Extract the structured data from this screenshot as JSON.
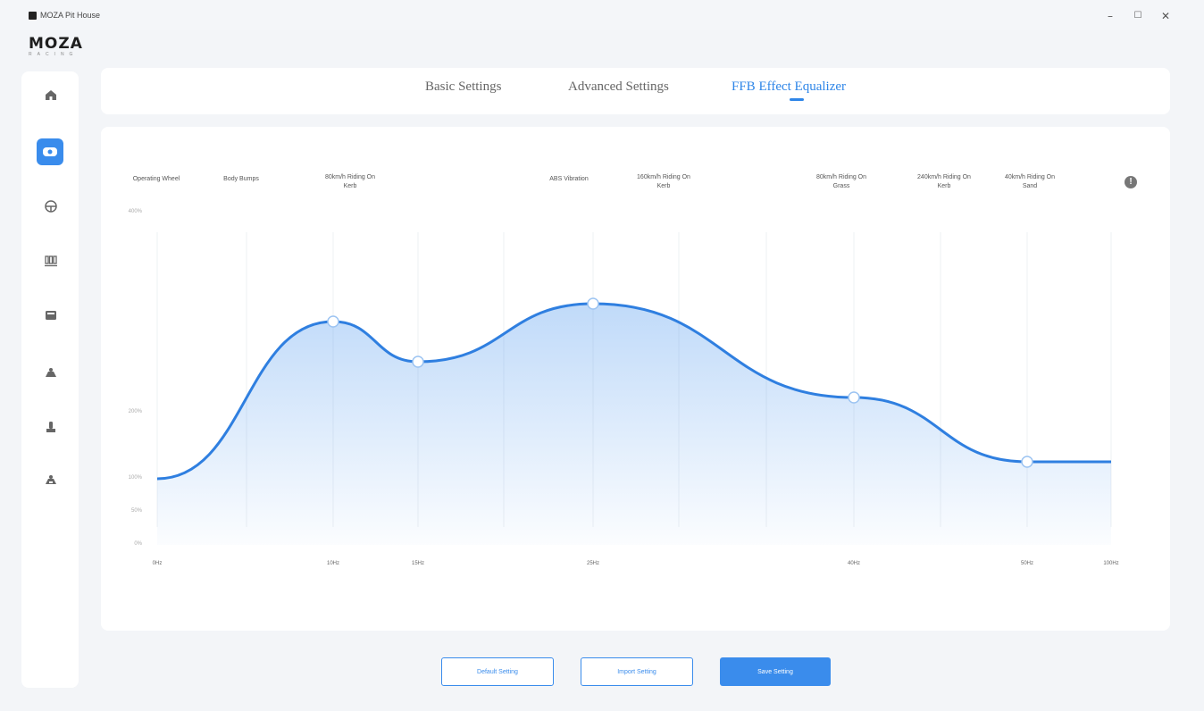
{
  "window": {
    "title": "MOZA Pit House",
    "minimize": "–",
    "maximize": "☐",
    "close": "✕"
  },
  "brand": {
    "logo": "MOZA",
    "subtitle": "RACING"
  },
  "sidebar": {
    "items": [
      {
        "icon": "home-icon"
      },
      {
        "icon": "wheelbase-icon",
        "active": true
      },
      {
        "icon": "steering-wheel-icon"
      },
      {
        "icon": "pedals-icon"
      },
      {
        "icon": "dashboard-icon"
      },
      {
        "icon": "shifter-icon"
      },
      {
        "icon": "handbrake-icon"
      },
      {
        "icon": "accessory-icon"
      }
    ]
  },
  "tabs": [
    {
      "label": "Basic Settings",
      "active": false
    },
    {
      "label": "Advanced Settings",
      "active": false
    },
    {
      "label": "FFB Effect Equalizer",
      "active": true
    }
  ],
  "chart_data": {
    "type": "area",
    "effect_labels": [
      "Operating Wheel",
      "Body Bumps",
      "80km/h Riding On Kerb",
      "ABS Vibration",
      "160km/h Riding On Kerb",
      "80km/h Riding On Grass",
      "240km/h Riding On Kerb",
      "40km/h Riding On Sand"
    ],
    "y_tick_labels": [
      "400%",
      "200%",
      "100%",
      "50%",
      "0%"
    ],
    "x_tick_labels": [
      "0Hz",
      "10Hz",
      "15Hz",
      "25Hz",
      "40Hz",
      "50Hz",
      "100Hz"
    ],
    "series": [
      {
        "points": [
          {
            "x": "0Hz",
            "y": 100
          },
          {
            "x": "10Hz",
            "y": 300
          },
          {
            "x": "15Hz",
            "y": 255
          },
          {
            "x": "25Hz",
            "y": 320
          },
          {
            "x": "40Hz",
            "y": 215
          },
          {
            "x": "50Hz",
            "y": 125
          },
          {
            "x": "100Hz",
            "y": 125
          }
        ]
      }
    ],
    "ylim": [
      0,
      400
    ],
    "grid": true,
    "line_color": "#2f7fe0",
    "fill_color": "#3a8cec"
  },
  "actions": {
    "default_label": "Default Setting",
    "import_label": "Import Setting",
    "save_label": "Save Setting"
  },
  "info_glyph": "!"
}
